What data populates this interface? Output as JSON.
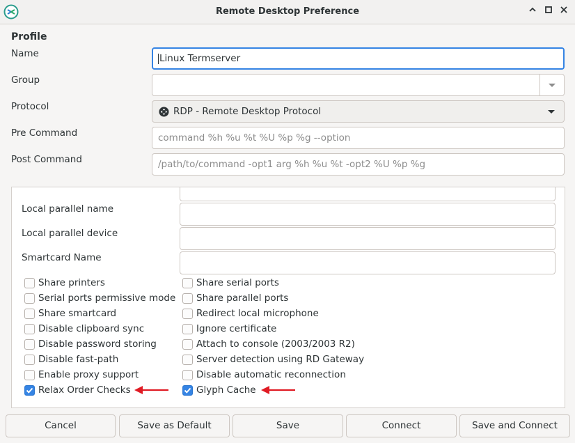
{
  "window": {
    "title": "Remote Desktop Preference",
    "controls": [
      "minimize-icon",
      "maximize-icon",
      "close-icon"
    ]
  },
  "profile": {
    "section_title": "Profile",
    "name_label": "Name",
    "name_value": "Linux Termserver",
    "group_label": "Group",
    "group_value": "",
    "protocol_label": "Protocol",
    "protocol_value": "RDP - Remote Desktop Protocol",
    "pre_command_label": "Pre Command",
    "pre_command_placeholder": "command %h %u %t %U %p %g --option",
    "post_command_label": "Post Command",
    "post_command_placeholder": "/path/to/command -opt1 arg %h %u %t -opt2 %U %p %g"
  },
  "advanced": {
    "local_parallel_name_label": "Local parallel name",
    "local_parallel_device_label": "Local parallel device",
    "smartcard_name_label": "Smartcard Name",
    "options_left": [
      {
        "label": "Share printers",
        "checked": false
      },
      {
        "label": "Serial ports permissive mode",
        "checked": false
      },
      {
        "label": "Share smartcard",
        "checked": false
      },
      {
        "label": "Disable clipboard sync",
        "checked": false
      },
      {
        "label": "Disable password storing",
        "checked": false
      },
      {
        "label": "Disable fast-path",
        "checked": false
      },
      {
        "label": "Enable proxy support",
        "checked": false
      },
      {
        "label": "Relax Order Checks",
        "checked": true
      }
    ],
    "options_right": [
      {
        "label": "Share serial ports",
        "checked": false
      },
      {
        "label": "Share parallel ports",
        "checked": false
      },
      {
        "label": "Redirect local microphone",
        "checked": false
      },
      {
        "label": "Ignore certificate",
        "checked": false
      },
      {
        "label": "Attach to console (2003/2003 R2)",
        "checked": false
      },
      {
        "label": "Server detection using RD Gateway",
        "checked": false
      },
      {
        "label": "Disable automatic reconnection",
        "checked": false
      },
      {
        "label": "Glyph Cache",
        "checked": true
      }
    ]
  },
  "buttons": {
    "cancel": "Cancel",
    "save_as_default": "Save as Default",
    "save": "Save",
    "connect": "Connect",
    "save_and_connect": "Save and Connect"
  },
  "colors": {
    "accent": "#3584e4",
    "annotation_arrow": "#e01b24",
    "app_icon": "#26a269"
  }
}
